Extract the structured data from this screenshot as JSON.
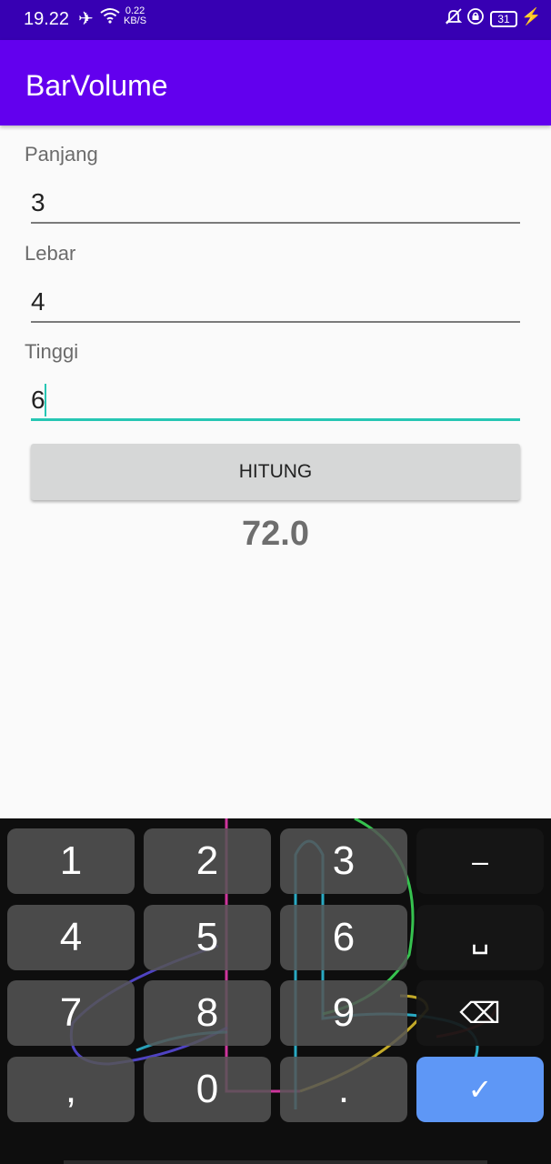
{
  "status_bar": {
    "time": "19.22",
    "net_speed_value": "0.22",
    "net_speed_unit": "KB/S",
    "battery": "31",
    "icons": [
      "airplane-icon",
      "wifi-icon",
      "bell-off-icon",
      "lock-rotation-icon",
      "battery-icon",
      "charging-icon"
    ]
  },
  "app_bar": {
    "title": "BarVolume"
  },
  "form": {
    "panjang_label": "Panjang",
    "panjang_value": "3",
    "lebar_label": "Lebar",
    "lebar_value": "4",
    "tinggi_label": "Tinggi",
    "tinggi_value": "6",
    "button_label": "HITUNG",
    "result": "72.0"
  },
  "keyboard": {
    "keys": [
      "1",
      "2",
      "3",
      "–",
      "4",
      "5",
      "6",
      "␣",
      "7",
      "8",
      "9",
      "⌫",
      ",",
      "0",
      ".",
      "✓"
    ],
    "colors": {
      "key": "#555555",
      "action": "#5e97f6",
      "accent": "#26c6b3"
    }
  }
}
